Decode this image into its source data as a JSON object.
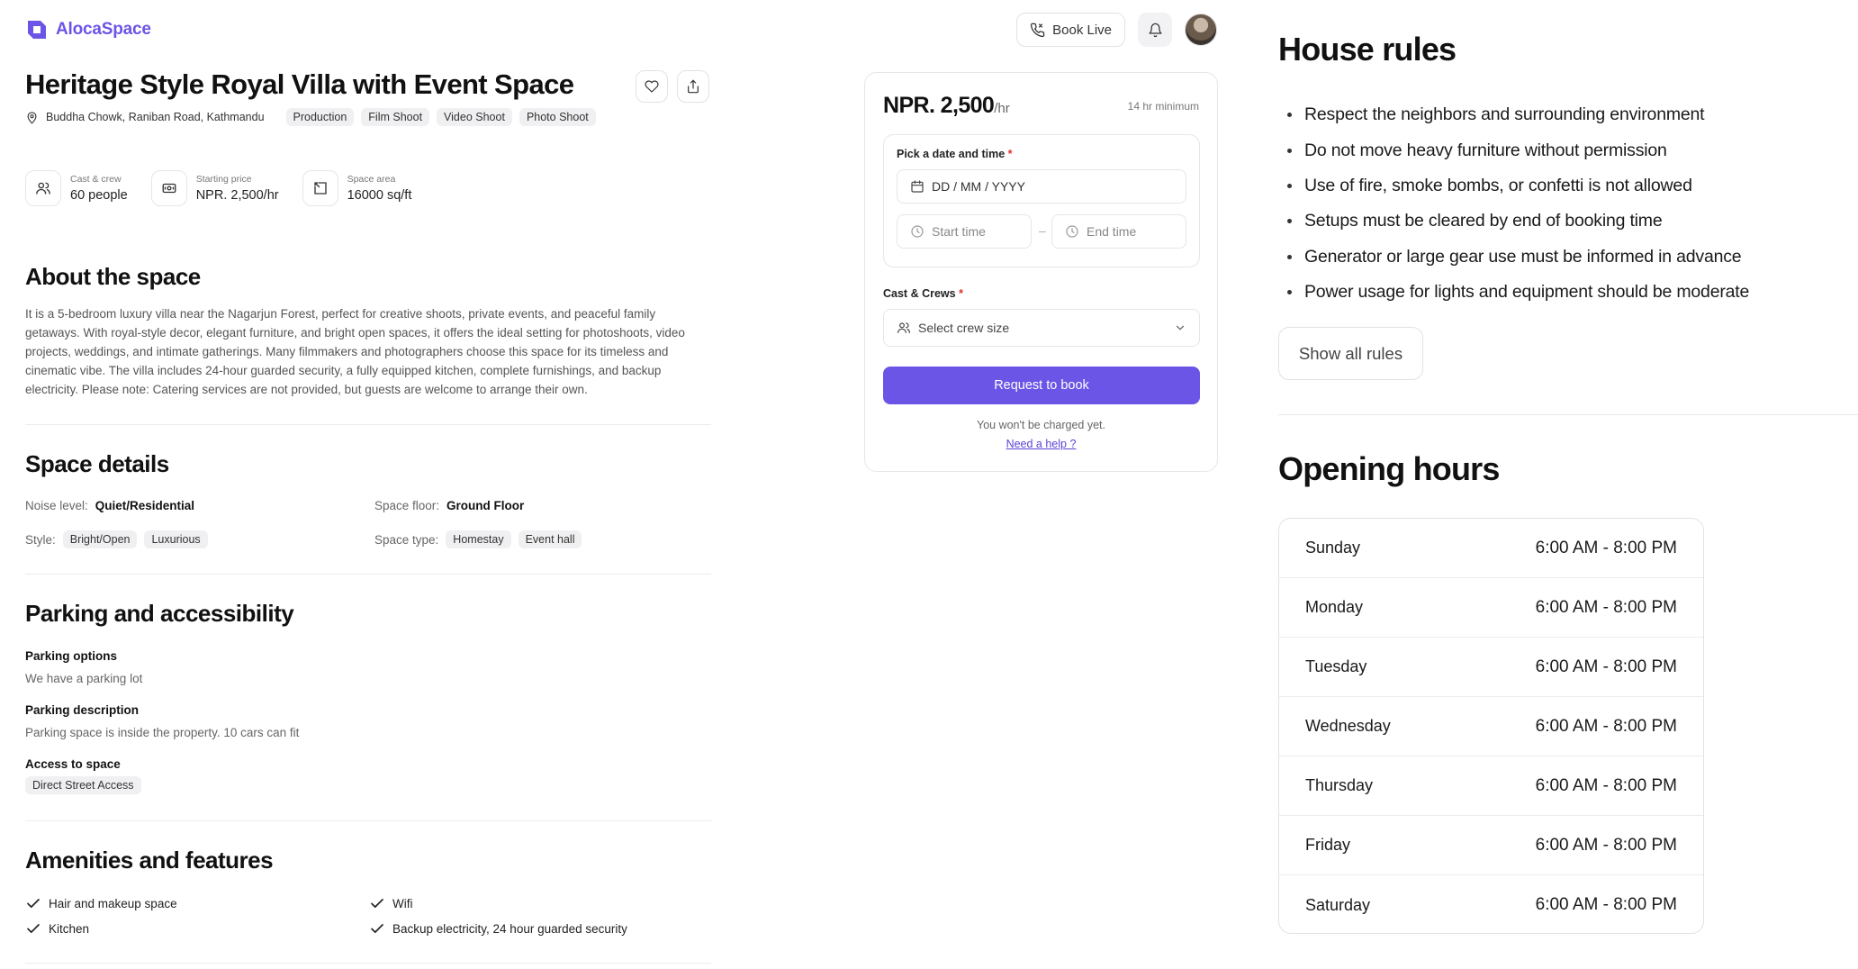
{
  "brand": {
    "name": "AlocaSpace",
    "color": "#6b55e6"
  },
  "topbar": {
    "book_live": "Book Live",
    "bell_icon": "bell-icon",
    "avatar_icon": "user-avatar"
  },
  "listing": {
    "title": "Heritage Style Royal Villa with Event Space",
    "location": "Buddha Chowk, Raniban Road, Kathmandu",
    "tags": [
      "Production",
      "Film Shoot",
      "Video Shoot",
      "Photo Shoot"
    ],
    "stats": [
      {
        "label": "Cast & crew",
        "value": "60 people",
        "icon": "users-icon"
      },
      {
        "label": "Starting price",
        "value": "NPR. 2,500/hr",
        "icon": "cash-icon"
      },
      {
        "label": "Space area",
        "value": "16000 sq/ft",
        "icon": "area-icon"
      }
    ]
  },
  "about": {
    "heading": "About the space",
    "text": "It is a 5-bedroom luxury villa near the Nagarjun Forest, perfect for creative shoots, private events, and peaceful family getaways. With royal-style decor, elegant furniture, and bright open spaces, it offers the ideal setting for photoshoots, video projects, weddings, and intimate gatherings. Many filmmakers and photographers choose this space for its timeless and cinematic vibe. The villa includes 24-hour guarded security, a fully equipped kitchen, complete furnishings, and backup electricity. Please note: Catering services are not provided, but guests are welcome to arrange their own."
  },
  "details": {
    "heading": "Space details",
    "noise_label": "Noise level:",
    "noise_value": "Quiet/Residential",
    "floor_label": "Space floor:",
    "floor_value": "Ground Floor",
    "style_label": "Style:",
    "style_tags": [
      "Bright/Open",
      "Luxurious"
    ],
    "type_label": "Space type:",
    "type_tags": [
      "Homestay",
      "Event hall"
    ]
  },
  "parking": {
    "heading": "Parking and accessibility",
    "options_label": "Parking options",
    "options_value": "We have a parking lot",
    "desc_label": "Parking description",
    "desc_value": "Parking space is inside the property. 10 cars can fit",
    "access_label": "Access to space",
    "access_tag": "Direct Street Access"
  },
  "amenities": {
    "heading": "Amenities and features",
    "items": [
      "Hair and makeup space",
      "Wifi",
      "Kitchen",
      "Backup electricity, 24 hour guarded security"
    ]
  },
  "booking": {
    "price": "NPR. 2,500",
    "per": "/hr",
    "minimum": "14 hr minimum",
    "date_label": "Pick a date and time",
    "required_mark": "*",
    "date_placeholder": "DD / MM / YYYY",
    "start_placeholder": "Start time",
    "end_placeholder": "End time",
    "dash": "–",
    "crew_label": "Cast & Crews",
    "crew_placeholder": "Select crew size",
    "button": "Request to book",
    "charge_note": "You won't be charged yet.",
    "help": "Need a help ?"
  },
  "house_rules": {
    "heading": "House rules",
    "items": [
      "Respect the neighbors and surrounding environment",
      "Do not move heavy furniture without permission",
      "Use of fire, smoke bombs, or confetti is not allowed",
      "Setups must be cleared by end of booking time",
      "Generator or large gear use must be informed in advance",
      "Power usage for lights and equipment should be moderate"
    ],
    "show_all": "Show all rules"
  },
  "opening_hours": {
    "heading": "Opening hours",
    "rows": [
      {
        "day": "Sunday",
        "time": "6:00 AM - 8:00 PM"
      },
      {
        "day": "Monday",
        "time": "6:00 AM - 8:00 PM"
      },
      {
        "day": "Tuesday",
        "time": "6:00 AM - 8:00 PM"
      },
      {
        "day": "Wednesday",
        "time": "6:00 AM - 8:00 PM"
      },
      {
        "day": "Thursday",
        "time": "6:00 AM - 8:00 PM"
      },
      {
        "day": "Friday",
        "time": "6:00 AM - 8:00 PM"
      },
      {
        "day": "Saturday",
        "time": "6:00 AM - 8:00 PM"
      }
    ]
  }
}
